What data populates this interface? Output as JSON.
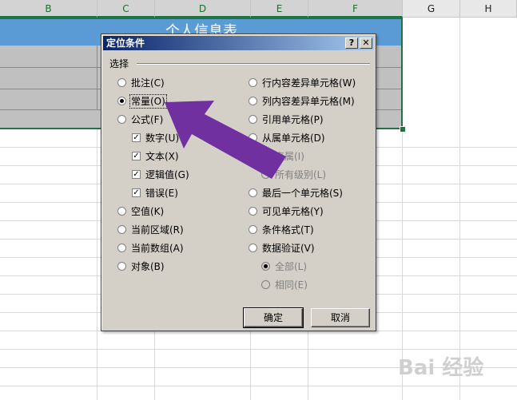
{
  "sheet": {
    "columns": [
      "B",
      "C",
      "D",
      "E",
      "F",
      "G",
      "H"
    ],
    "title_band_text": "个人信息表"
  },
  "dialog": {
    "title": "定位条件",
    "help_button": "?",
    "close_button": "✕",
    "group_label": "选择",
    "left_options": [
      {
        "label": "批注(C)",
        "kind": "radio",
        "checked": false
      },
      {
        "label": "常量(O)",
        "kind": "radio",
        "checked": true
      },
      {
        "label": "公式(F)",
        "kind": "radio",
        "checked": false
      },
      {
        "label": "数字(U)",
        "kind": "check",
        "checked": true
      },
      {
        "label": "文本(X)",
        "kind": "check",
        "checked": true
      },
      {
        "label": "逻辑值(G)",
        "kind": "check",
        "checked": true
      },
      {
        "label": "错误(E)",
        "kind": "check",
        "checked": true
      },
      {
        "label": "空值(K)",
        "kind": "radio",
        "checked": false
      },
      {
        "label": "当前区域(R)",
        "kind": "radio",
        "checked": false
      },
      {
        "label": "当前数组(A)",
        "kind": "radio",
        "checked": false
      },
      {
        "label": "对象(B)",
        "kind": "radio",
        "checked": false
      }
    ],
    "right_options": [
      {
        "label": "行内容差异单元格(W)",
        "kind": "radio",
        "checked": false
      },
      {
        "label": "列内容差异单元格(M)",
        "kind": "radio",
        "checked": false
      },
      {
        "label": "引用单元格(P)",
        "kind": "radio",
        "checked": false
      },
      {
        "label": "从属单元格(D)",
        "kind": "radio",
        "checked": false
      },
      {
        "label": "直属(I)",
        "kind": "radio",
        "checked": false,
        "disabled": true
      },
      {
        "label": "所有级别(L)",
        "kind": "radio",
        "checked": false,
        "disabled": true
      },
      {
        "label": "最后一个单元格(S)",
        "kind": "radio",
        "checked": false
      },
      {
        "label": "可见单元格(Y)",
        "kind": "radio",
        "checked": false
      },
      {
        "label": "条件格式(T)",
        "kind": "radio",
        "checked": false
      },
      {
        "label": "数据验证(V)",
        "kind": "radio",
        "checked": false
      },
      {
        "label": "全部(L)",
        "kind": "radio",
        "checked": true,
        "disabled": true
      },
      {
        "label": "相同(E)",
        "kind": "radio",
        "checked": false,
        "disabled": true
      }
    ],
    "ok_label": "确定",
    "cancel_label": "取消"
  },
  "watermark": "Bai 经验",
  "colors": {
    "title_band": "#5b9bd5",
    "arrow": "#7030a0",
    "selection": "#217346"
  }
}
